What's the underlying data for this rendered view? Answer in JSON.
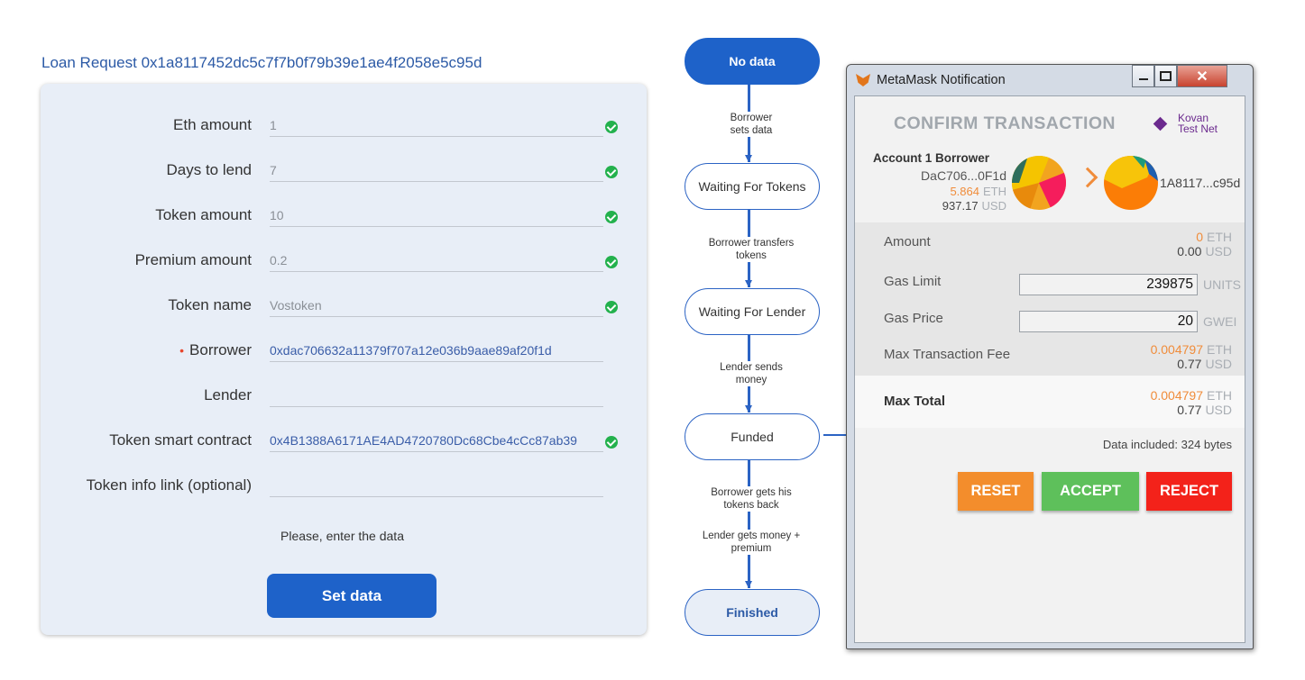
{
  "loan": {
    "title": "Loan Request 0x1a8117452dc5c7f7b0f79b39e1ae4f2058e5c95d",
    "fields": [
      {
        "label": "Eth amount",
        "value": "1"
      },
      {
        "label": "Days to lend",
        "value": "7"
      },
      {
        "label": "Token amount",
        "value": "10"
      },
      {
        "label": "Premium amount",
        "value": "0.2"
      },
      {
        "label": "Token name",
        "value": "Vostoken"
      },
      {
        "label": "Borrower",
        "value": "0xdac706632a11379f707a12e036b9aae89af20f1d",
        "required_mark": "•"
      },
      {
        "label": "Lender",
        "value": ""
      },
      {
        "label": "Token smart contract",
        "value": "0x4B1388A6171AE4AD4720780Dc68Cbe4cCc87ab39"
      },
      {
        "label": "Token info link (optional)",
        "value": ""
      }
    ],
    "hint": "Please, enter the data",
    "set_button": "Set data",
    "colors": {
      "accent": "#1e62c9",
      "valid": "#23b14d",
      "required": "#e8462c"
    }
  },
  "flow": {
    "nodes": [
      "No data",
      "Waiting For Tokens",
      "Waiting For Lender",
      "Funded",
      "Finished"
    ],
    "active": "No data",
    "edges": [
      "Borrower sets data",
      "Borrower transfers tokens",
      "Lender sends money",
      "Borrower gets his tokens back",
      "Lender gets money + premium"
    ]
  },
  "metamask": {
    "window_title": "MetaMask Notification",
    "window_buttons": {
      "minimize": "minimize-icon",
      "maximize": "maximize-icon",
      "close": "✕"
    },
    "heading": "CONFIRM TRANSACTION",
    "network": {
      "line1": "Kovan",
      "line2": "Test Net"
    },
    "account": {
      "name": "Account 1 Borrower",
      "address": "DaC706...0F1d",
      "eth": "5.864",
      "eth_unit": "ETH",
      "usd": "937.17",
      "usd_unit": "USD"
    },
    "recipient": {
      "address": "1A8117...c95d"
    },
    "amount": {
      "label": "Amount",
      "eth": "0",
      "eth_unit": "ETH",
      "usd": "0.00",
      "usd_unit": "USD"
    },
    "gas_limit": {
      "label": "Gas Limit",
      "value": "239875",
      "unit": "UNITS"
    },
    "gas_price": {
      "label": "Gas Price",
      "value": "20",
      "unit": "GWEI"
    },
    "max_fee": {
      "label": "Max Transaction Fee",
      "eth": "0.004797",
      "eth_unit": "ETH",
      "usd": "0.77",
      "usd_unit": "USD"
    },
    "max_total": {
      "label": "Max Total",
      "eth": "0.004797",
      "eth_unit": "ETH",
      "usd": "0.77",
      "usd_unit": "USD"
    },
    "data_included": "Data included: 324 bytes",
    "buttons": {
      "reset": "RESET",
      "accept": "ACCEPT",
      "reject": "REJECT"
    },
    "colors": {
      "reset": "#f38d2c",
      "accept": "#5ec05b",
      "reject": "#f3221a",
      "orange_value": "#f08c3a"
    }
  }
}
